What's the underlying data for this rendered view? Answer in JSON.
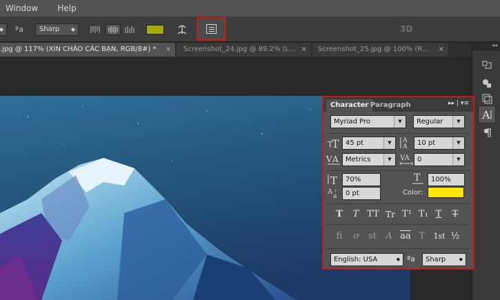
{
  "menubar": {
    "items": [
      "Window",
      "Help"
    ]
  },
  "options_bar": {
    "aa_glyph": "ª",
    "aa_sub": "a",
    "antialias_value": "Sharp",
    "text_color": "#a8a806",
    "three_d_label": "3D"
  },
  "tabs": [
    {
      "label": ".jpg @ 117% (XIN CHÀO CÁC BẠN, RGB/8#) *",
      "close": "×",
      "active": true
    },
    {
      "label": "Screenshot_24.jpg @ 89.2% (L...",
      "close": "×",
      "active": false
    },
    {
      "label": "Screenshot_25.jpg @ 100% (R...",
      "close": "×",
      "active": false
    }
  ],
  "dock": {
    "collapse": "◂◂"
  },
  "character_panel": {
    "tab_character": "Character",
    "tab_paragraph": "Paragraph",
    "menu_glyph": "▸▸ | ▾≡",
    "font_family": "Myriad Pro",
    "font_style": "Regular",
    "font_size": "45 pt",
    "leading": "10 pt",
    "kerning": "Metrics",
    "tracking": "0",
    "vertical_scale": "70%",
    "horizontal_scale": "100%",
    "baseline_shift": "0 pt",
    "color_label": "Color:",
    "color_value": "#ffe400",
    "type_buttons": [
      "T",
      "T",
      "TT",
      "Tr",
      "T¹",
      "T₁",
      "T",
      "T"
    ],
    "opentype_buttons": [
      "fi",
      "ơ",
      "st",
      "A",
      "aa",
      "T",
      "1st",
      "½"
    ],
    "language": "English: USA",
    "aa_glyph": "ªa",
    "antialias": "Sharp"
  }
}
